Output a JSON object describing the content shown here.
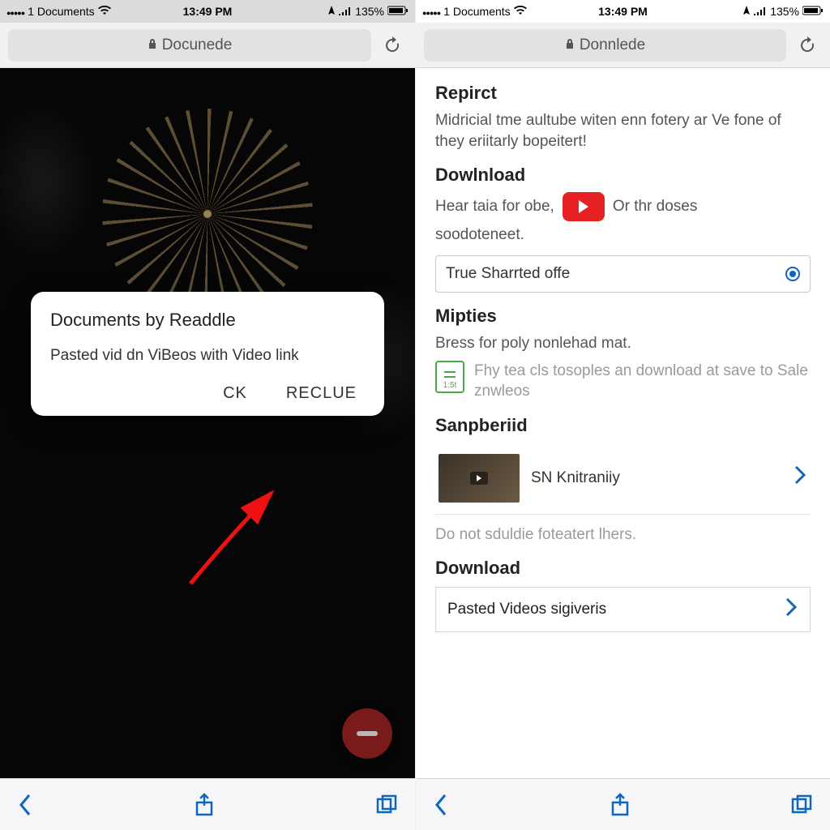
{
  "left": {
    "status": {
      "carrier": "1 Documents",
      "time": "13:49 PM",
      "battery": "135%"
    },
    "address": {
      "domain": "Docunede"
    },
    "dialog": {
      "title": "Documents by Readdle",
      "body": "Pasted vid dn ViBeos  with Video link",
      "cancel": "CK",
      "confirm": "RECLUE"
    }
  },
  "right": {
    "status": {
      "carrier": "1 Documents",
      "time": "13:49 PM",
      "battery": "135%"
    },
    "address": {
      "domain": "Donnlede"
    },
    "sections": {
      "repirct": {
        "title": "Repirct",
        "body": "Midricial tme aultube witen enn fotery ar Ve fone of they eriitarly bopeitert!"
      },
      "download": {
        "title": "Dowlnload",
        "line1": "Hear taia for obe,",
        "line2": "Or thr doses",
        "line3": "soodoteneet.",
        "input_value": "True Sharrted offe"
      },
      "mipties": {
        "title": "Mipties",
        "sub": "Bress for poly nonlehad mat.",
        "tiletext": "Fhy tea cls tosoples an download at save to Sale znwleos",
        "iconlabel": "1:5t"
      },
      "sanpberid": {
        "title": "Sanpberiid",
        "item_label": "SN Knitraniiy",
        "footer": "Do not sduldie foteatert lhers."
      },
      "download2": {
        "title": "Download",
        "item": "Pasted Videos sigiveris"
      }
    }
  }
}
